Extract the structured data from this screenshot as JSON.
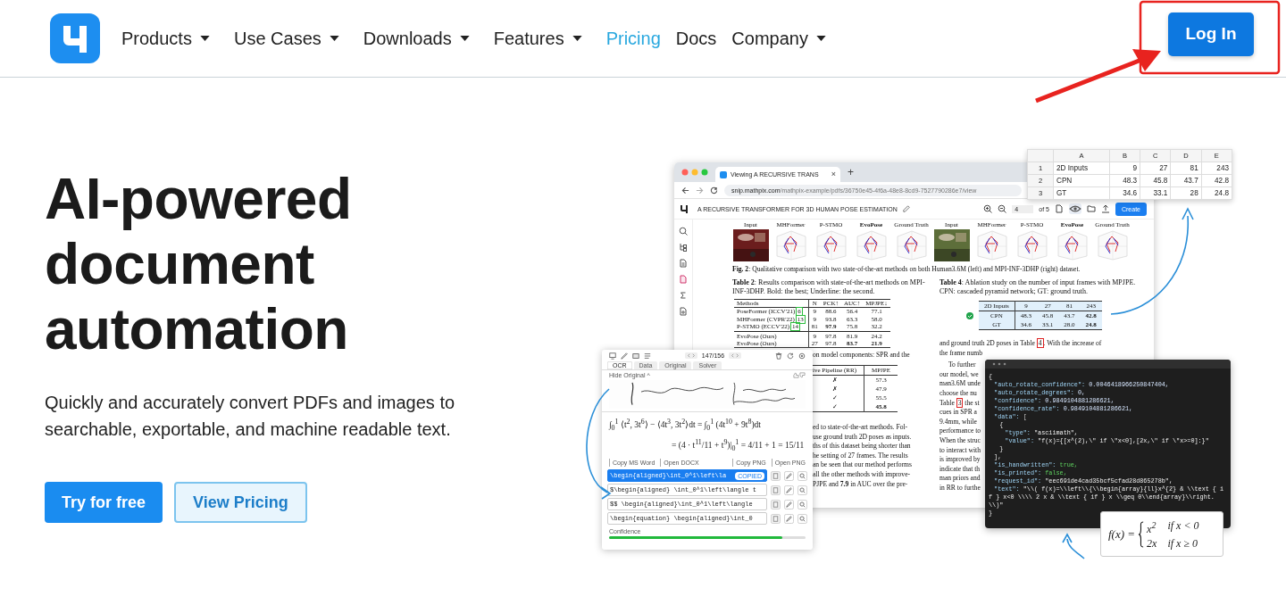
{
  "nav": {
    "items": [
      {
        "label": "Products",
        "dropdown": true,
        "selected": false
      },
      {
        "label": "Use Cases",
        "dropdown": true,
        "selected": false
      },
      {
        "label": "Downloads",
        "dropdown": true,
        "selected": false
      },
      {
        "label": "Features",
        "dropdown": true,
        "selected": false
      },
      {
        "label": "Pricing",
        "dropdown": false,
        "selected": true
      },
      {
        "label": "Docs",
        "dropdown": false,
        "selected": false
      },
      {
        "label": "Company",
        "dropdown": true,
        "selected": false
      }
    ],
    "login": "Log In"
  },
  "hero": {
    "title": "AI-powered document automation",
    "subtitle": "Quickly and accurately convert PDFs and images to searchable, exportable, and machine readable text.",
    "buttons": [
      {
        "label": "Try for free",
        "kind": "primary"
      },
      {
        "label": "View Pricing",
        "kind": "secondary"
      }
    ]
  },
  "illustration": {
    "spreadsheet": {
      "columns": [
        "",
        "A",
        "B",
        "C",
        "D",
        "E"
      ],
      "rows": [
        [
          "1",
          "2D Inputs",
          "9",
          "27",
          "81",
          "243"
        ],
        [
          "2",
          "CPN",
          "48.3",
          "45.8",
          "43.7",
          "42.8"
        ],
        [
          "3",
          "GT",
          "34.6",
          "33.1",
          "28",
          "24.8"
        ]
      ]
    },
    "browser": {
      "tab_title": "Viewing A RECURSIVE TRANS",
      "tab_close": "×",
      "new_tab": "+",
      "url_host": "snip.mathpix.com",
      "url_path": "/mathpix-example/pdfs/36750e45-4f6a-48e8-8cd9-7527790286e7/view",
      "doc_title": "A RECURSIVE TRANSFORMER FOR 3D HUMAN POSE ESTIMATION",
      "page": "4",
      "page_total": "of 5",
      "create": "Create",
      "figures": [
        {
          "label": "Input",
          "emphasis": false,
          "color": "#6b1d1d"
        },
        {
          "label": "MHFormer",
          "kind": "plot",
          "emphasis": false
        },
        {
          "label": "P-STMO",
          "kind": "plot",
          "emphasis": false
        },
        {
          "label": "EvoPose",
          "kind": "plot",
          "emphasis": true
        },
        {
          "label": "Ground Truth",
          "kind": "plot",
          "emphasis": false
        },
        {
          "label": "Input",
          "emphasis": false,
          "color": "#5d6e3a"
        },
        {
          "label": "MHFormer",
          "kind": "plot",
          "emphasis": false
        },
        {
          "label": "P-STMO",
          "kind": "plot",
          "emphasis": false
        },
        {
          "label": "EvoPose",
          "kind": "plot",
          "emphasis": true
        },
        {
          "label": "Ground Truth",
          "kind": "plot",
          "emphasis": false
        }
      ],
      "caption": "**Fig. 2**: Qualitative comparison with two state-of-the-art methods on both Human3.6M (left) and MPI-INF-3DHP (right) dataset.",
      "table2": {
        "caption": "**Table 2**: Results comparison with state-of-the-art methods on MPI-INF-3DHP. Bold: the best; Underline: the second.",
        "columns": [
          "Methods",
          "N",
          "PCK↑",
          "AUC↑",
          "MPJPE↓"
        ],
        "rows": [
          {
            "separator": false,
            "cite": "6",
            "cells": [
              "PoseFormer (ICCV'21)",
              "9",
              "88.6",
              "56.4",
              "77.1"
            ]
          },
          {
            "separator": false,
            "cite": "13",
            "cells": [
              "MHFormer (CVPR'22)",
              "9",
              "93.8",
              "63.3",
              "58.0"
            ]
          },
          {
            "separator": false,
            "cite": "14",
            "cells": [
              "P-STMO (ECCV'22)",
              "81",
              "**97.9**",
              "75.8",
              "32.2"
            ]
          },
          {
            "separator": true,
            "cells": [
              "EvoPose (Ours)",
              "9",
              "97.8",
              "81.9",
              "24.2"
            ]
          },
          {
            "separator": false,
            "cells": [
              "EvoPose (Ours)",
              "27",
              "97.8",
              "**83.7**",
              "**21.9**"
            ]
          }
        ]
      },
      "fragment_line": "on model components: SPR and the",
      "table3": {
        "columns": [
          "ive Pipeline (RR)",
          "MPJPE"
        ],
        "rows": [
          [
            "✗",
            "57.3"
          ],
          [
            "✗",
            "47.9"
          ],
          [
            "✓",
            "55.5"
          ],
          [
            "✓",
            "**45.8**"
          ]
        ]
      },
      "left_lines": [
        "ed to state-of-the-art methods. Fol-",
        "use ground truth 2D poses as inputs.",
        "ths of this dataset being shorter than",
        "he setting of 27 frames. The results",
        "an be seen that our method performs",
        "all the other methods with improve-",
        "PJPE and **7.9** in AUC over the pre-"
      ],
      "table4": {
        "caption": "**Table 4**: Ablation study on the number of input frames with MPJPE. CPN: cascaded pyramid network; GT: ground truth.",
        "selected": true,
        "columns": [
          "2D Inputs",
          "9",
          "27",
          "81",
          "243"
        ],
        "rows": [
          [
            "CPN",
            "48.3",
            "45.8",
            "43.7",
            "**42.8**"
          ],
          [
            "GT",
            "34.6",
            "33.1",
            "28.0",
            "**24.8**"
          ]
        ]
      },
      "right_lines": [
        {
          "text": "and ground truth 2D poses in Table ",
          "ref": "4",
          "after": ". With the increase of",
          "indent": false
        },
        {
          "text": "the frame numb",
          "indent": false
        },
        {
          "text": "To further",
          "indent": true
        },
        {
          "text": "our model, we",
          "indent": false
        },
        {
          "text": "man3.6M unde",
          "indent": false
        },
        {
          "text": "choose the nu",
          "indent": false
        },
        {
          "text": "Table ",
          "ref": "3",
          "after": " the st",
          "indent": false
        },
        {
          "text": "cues in SPR a",
          "indent": false
        },
        {
          "text": "9.4mm, while",
          "indent": false
        },
        {
          "text": "performance to",
          "indent": false
        },
        {
          "text": "When the struc",
          "indent": false
        },
        {
          "text": "to interact with",
          "indent": false
        },
        {
          "text": "is improved by",
          "indent": false
        },
        {
          "text": "indicate that th",
          "indent": false
        },
        {
          "text": "man priors and",
          "indent": false
        },
        {
          "text": "in RR to furthe",
          "indent": false
        }
      ]
    },
    "app": {
      "pager": "147/156",
      "tabs": [
        {
          "label": "OCR",
          "selected": true
        },
        {
          "label": "Data",
          "selected": false
        },
        {
          "label": "Original",
          "selected": false
        },
        {
          "label": "Solver",
          "selected": false
        }
      ],
      "hide_original": "Hide Original ^",
      "math": [
        "∫$_{0}$$^{1}$ ⟨t$^{2}$, 3t$^{6}$⟩ − ⟨4t$^{3}$, 3t$^{2}$⟩dt = ∫$_{0}$$^{1}$ (4t$^{10}$ + 9t$^{8}$)dt",
        "= (4 · t$^{11}$/11 + t$^{9}$)|$_{0}$$^{1}$ = 4/11 + 1 = 15/11"
      ],
      "actions_left": [
        "Copy MS Word",
        "Open DOCX"
      ],
      "actions_right": [
        "Copy PNG",
        "Open PNG"
      ],
      "results": [
        {
          "text": "\\begin{aligned}\\int_0^1\\left\\la",
          "selected": true,
          "badge": "COPIED"
        },
        {
          "text": "$\\begin{aligned} \\int_0^1\\left\\langle t",
          "selected": false
        },
        {
          "text": "$$ \\begin{aligned}\\int_0^1\\left\\langle",
          "selected": false
        },
        {
          "text": "\\begin{equation} \\begin{aligned}\\int_0",
          "selected": false
        }
      ],
      "confidence_label": "Confidence",
      "confidence": {
        "level": 0.88
      }
    },
    "code": {
      "root": {
        "text": "{",
        "close": "}",
        "children": [
          {
            "key": "\"auto_rotate_confidence\":",
            "value": "0.0046418966250847404,",
            "kind": "number"
          },
          {
            "key": "\"auto_rotate_degrees\":",
            "value": "0,",
            "kind": "number"
          },
          {
            "key": "\"confidence\":",
            "value": "0.9849104881286621,",
            "kind": "number"
          },
          {
            "key": "\"confidence_rate\":",
            "value": "0.9849104881286621,",
            "kind": "number"
          },
          {
            "key": "\"data\":",
            "value": "[",
            "kind": "punct",
            "close": "],",
            "children": [
              {
                "text": "{",
                "close": "}",
                "children": [
                  {
                    "key": "\"type\":",
                    "value": "\"asciimath\",",
                    "kind": "string"
                  },
                  {
                    "key": "\"value\":",
                    "value": "\"f(x)={[x^(2),\\\" if \\\"x<0],[2x,\\\" if \\\"x>=0]:}\"",
                    "kind": "string"
                  }
                ]
              }
            ]
          },
          {
            "key": "\"is_handwritten\":",
            "value": "true,",
            "kind": "bool"
          },
          {
            "key": "\"is_printed\":",
            "value": "false,",
            "kind": "bool"
          },
          {
            "key": "\"request_id\":",
            "value": "\"eec691de4cad35bcf5cfad28d865278b\",",
            "kind": "string"
          },
          {
            "key": "\"text\":",
            "value": "\"\\\\( f(x)=\\\\left\\\\{\\\\begin{array}{ll}x^{2} & \\\\text { if } x<0 \\\\\\\\ 2 x & \\\\text { if } x \\\\geq 0\\\\end{array}\\\\right. \\\\)\"",
            "kind": "string"
          }
        ]
      }
    },
    "formula": {
      "lhs": "f(x) =",
      "cases": [
        {
          "value": "x$^{2}$",
          "condition": "if x < 0"
        },
        {
          "value": "2x",
          "condition": "if x ≥ 0"
        }
      ]
    }
  }
}
